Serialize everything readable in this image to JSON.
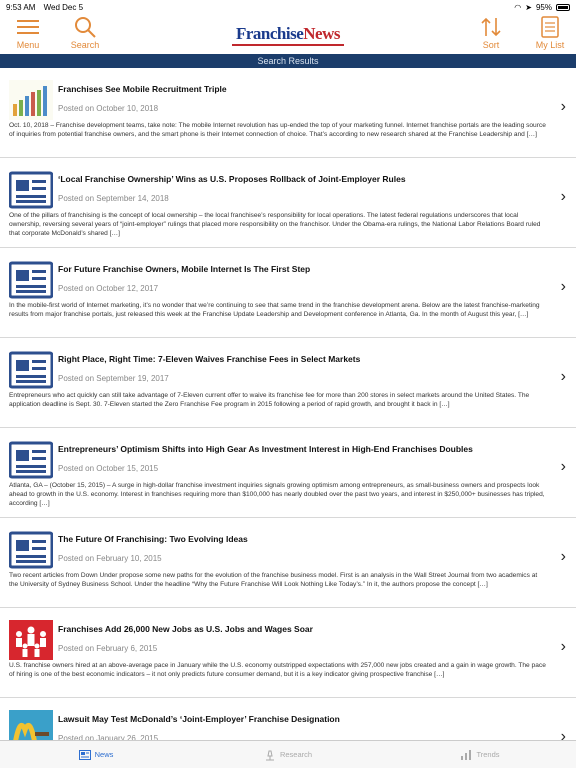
{
  "status": {
    "time": "9:53 AM",
    "date": "Wed Dec 5",
    "battery": "95%"
  },
  "toolbar": {
    "menu_label": "Menu",
    "search_label": "Search",
    "sort_label": "Sort",
    "mylist_label": "My List",
    "logo_text_1": "Franchise",
    "logo_text_2": "News"
  },
  "section_title": "Search Results",
  "articles": [
    {
      "thumb": "chart-thumbnail",
      "title": "Franchises See Mobile Recruitment Triple",
      "date": "Posted on October 10, 2018",
      "excerpt": "Oct. 10, 2018 – Franchise development teams, take note: The mobile Internet revolution has up-ended the top of your marketing funnel. Internet franchise portals are the leading source of inquiries from potential franchise owners, and the smart phone is their Internet connection of choice. That’s according to new research shared at the Franchise Leadership and […]"
    },
    {
      "thumb": "news-icon",
      "title": "‘Local Franchise Ownership’ Wins as U.S. Proposes Rollback of Joint-Employer Rules",
      "date": "Posted on September 14, 2018",
      "excerpt": "One of the pillars of franchising is the concept of local ownership – the local franchisee’s responsibility for local operations. The latest federal regulations underscores that local ownership, reversing several years of “joint-employer” rulings that placed more responsibility on the franchisor. Under the Obama-era rulings, the National Labor Relations Board ruled that corporate McDonald’s shared […]"
    },
    {
      "thumb": "news-icon",
      "title": "For Future Franchise Owners, Mobile Internet Is The First Step",
      "date": "Posted on October 12, 2017",
      "excerpt": "In the mobile-first world of Internet marketing, it’s no wonder that we’re continuing to see that same trend in the franchise development arena. Below are the latest franchise-marketing results from major franchise portals, just released this week at the  Franchise Update Leadership and Development conference in Atlanta, Ga. In the month of August this year, […]"
    },
    {
      "thumb": "news-icon",
      "title": "Right Place, Right Time: 7-Eleven Waives Franchise Fees in Select Markets",
      "date": "Posted on September 19, 2017",
      "excerpt": "Entrepreneurs who act quickly can still take advantage of 7-Eleven current offer to waive its franchise fee for more than 200 stores in select markets around the United States.  The application deadline is Sept. 30. 7-Eleven started the Zero Franchise Fee program in 2015 following a period of rapid growth, and brought it back in […]"
    },
    {
      "thumb": "news-icon",
      "title": "Entrepreneurs’ Optimism Shifts into High Gear  As Investment Interest in High-End Franchises Doubles",
      "date": "Posted on October 15, 2015",
      "excerpt": "Atlanta, GA – (October 15, 2015) – A surge in high-dollar franchise investment inquiries signals growing optimism among entrepreneurs, as small-business owners and prospects look ahead to growth in the U.S. economy. Interest in franchises requiring more than $100,000 has nearly doubled over the past two years, and interest in $250,000+ businesses has tripled, according […]"
    },
    {
      "thumb": "news-icon",
      "title": "The Future Of Franchising: Two Evolving Ideas",
      "date": "Posted on February 10, 2015",
      "excerpt": "Two recent articles from Down Under propose some new paths for the evolution of the franchise business model. First is an analysis in the Wall Street Journal from two academics at the University of Sydney Business School. Under the headline “Why the Future Franchise Will Look Nothing Like Today’s.” In it, the authors propose the concept […]"
    },
    {
      "thumb": "people-thumbnail",
      "title": "Franchises Add 26,000 New Jobs as U.S. Jobs and Wages Soar",
      "date": "Posted on February 6, 2015",
      "excerpt": "U.S. franchise owners hired at an above-average pace in January while the U.S. economy outstripped expectations with 257,000 new jobs created and a gain in wage growth. The pace of hiring is one of the best economic indicators – it not only predicts future consumer demand, but it is a key indicator giving prospective franchise […]"
    },
    {
      "thumb": "mcdonalds-thumbnail",
      "title": "Lawsuit May Test McDonald’s ‘Joint-Employer’ Franchise Designation",
      "date": "Posted on January 26, 2015",
      "excerpt": ""
    }
  ],
  "tabs": [
    {
      "label": "News",
      "active": true
    },
    {
      "label": "Research",
      "active": false
    },
    {
      "label": "Trends",
      "active": false
    }
  ],
  "colors": {
    "accent": "#e28a3a",
    "navy": "#1b3d6b",
    "logo_red": "#c0282d",
    "tab_active": "#2e6fd0"
  }
}
